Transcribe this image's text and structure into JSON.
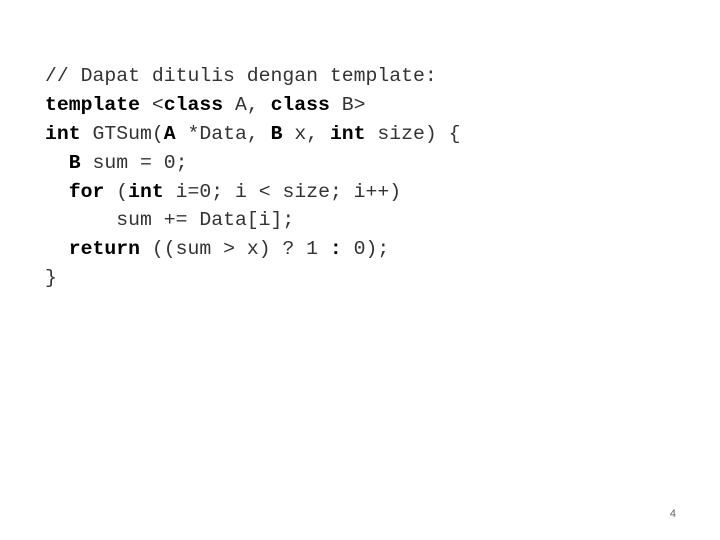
{
  "slide": {
    "page_number": "4",
    "code_lines": [
      {
        "indent": "",
        "tokens": [
          {
            "t": "// Dapat ditulis dengan template:",
            "k": false
          }
        ]
      },
      {
        "indent": "",
        "tokens": [
          {
            "t": "template",
            "k": true
          },
          {
            "t": " <",
            "k": false
          },
          {
            "t": "class",
            "k": true
          },
          {
            "t": " A, ",
            "k": false
          },
          {
            "t": "class",
            "k": true
          },
          {
            "t": " B>",
            "k": false
          }
        ]
      },
      {
        "indent": "",
        "tokens": [
          {
            "t": "int",
            "k": true
          },
          {
            "t": " GTSum(",
            "k": false
          },
          {
            "t": "A",
            "k": true
          },
          {
            "t": " *Data, ",
            "k": false
          },
          {
            "t": "B",
            "k": true
          },
          {
            "t": " x, ",
            "k": false
          },
          {
            "t": "int",
            "k": true
          },
          {
            "t": " size) {",
            "k": false
          }
        ]
      },
      {
        "indent": "  ",
        "tokens": [
          {
            "t": "B",
            "k": true
          },
          {
            "t": " sum = 0;",
            "k": false
          }
        ]
      },
      {
        "indent": "  ",
        "tokens": [
          {
            "t": "for",
            "k": true
          },
          {
            "t": " (",
            "k": false
          },
          {
            "t": "int",
            "k": true
          },
          {
            "t": " i=0; i < size; i++)",
            "k": false
          }
        ]
      },
      {
        "indent": "      ",
        "tokens": [
          {
            "t": "sum += Data[i];",
            "k": false
          }
        ]
      },
      {
        "indent": "  ",
        "tokens": [
          {
            "t": "return",
            "k": true
          },
          {
            "t": " ((sum > x) ? 1 ",
            "k": false
          },
          {
            "t": ":",
            "k": true
          },
          {
            "t": " 0);",
            "k": false
          }
        ]
      },
      {
        "indent": "",
        "tokens": [
          {
            "t": "}",
            "k": false
          }
        ]
      }
    ]
  }
}
